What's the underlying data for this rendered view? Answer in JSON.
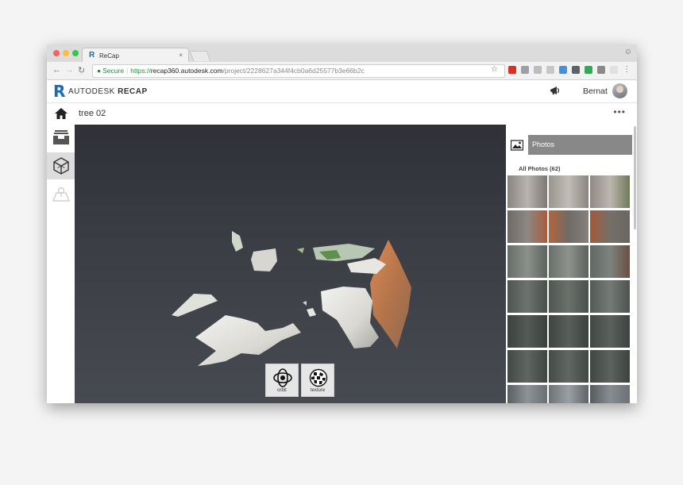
{
  "browser": {
    "tab_title": "ReCap",
    "tab_close": "×",
    "tab_favicon": "R",
    "url_secure_label": "Secure",
    "url_protocol": "https://",
    "url_host": "recap360.autodesk.com",
    "url_path": "/project/2228627a344f4cb0a6d25577b3e66b2c"
  },
  "header": {
    "logo_letter": "R",
    "brand_prefix": "AUTODESK",
    "brand_product": "RECAP",
    "username": "Bernat"
  },
  "project": {
    "title": "tree 02",
    "more_label": "•••"
  },
  "tools": [
    {
      "label": "orbit",
      "icon": "orbit-icon"
    },
    {
      "label": "texture",
      "icon": "texture-icon"
    }
  ],
  "panel": {
    "tab_label": "Photos",
    "all_photos_label": "All Photos (62)"
  },
  "colors": {
    "accent": "#1a6bb5",
    "secure_green": "#1e8f3c",
    "viewport_bg": "#3b3e45",
    "panel_tab": "#888888"
  }
}
